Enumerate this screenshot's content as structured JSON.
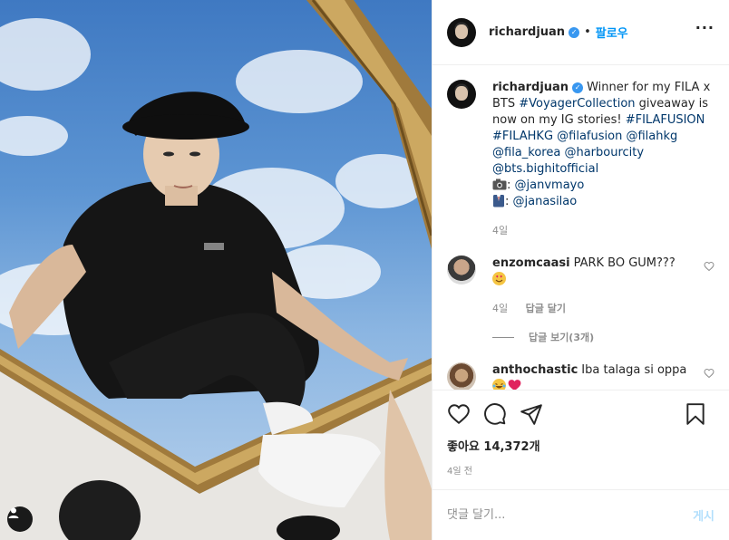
{
  "post": {
    "author": "richardjuan",
    "verified_icon": "verified-badge-icon",
    "separator": "•",
    "follow_label": "팔로우",
    "more_label": "···",
    "caption": {
      "text_intro": "Winner for my FILA x BTS ",
      "hashtag_voyager": "#VoyagerCollection",
      "text_mid": " giveaway is now on my IG stories! ",
      "hashtag_filafusion": "#FILAFUSION",
      "hashtag_filahkg": "#FILAHKG",
      "mention_filafusion": "@filafusion",
      "mention_filahkg": "@filahkg",
      "mention_fila_korea": "@fila_korea",
      "mention_harbourcity": "@harbourcity",
      "mention_bts": "@bts.bighitofficial",
      "camera_credit_label": ": ",
      "mention_janvmayo": "@janvmayo",
      "outfit_credit_label": ": ",
      "mention_janasilao": "@janasilao",
      "time": "4일"
    }
  },
  "comments": [
    {
      "user": "enzomcaasi",
      "text": "PARK BO GUM??? ",
      "emoji": "heart-eyes-emoji",
      "time": "4일",
      "reply_label": "답글 달기",
      "view_replies_label": "답글 보기(3개)"
    },
    {
      "user": "anthochastic",
      "text": "Iba talaga si oppa",
      "emoji": [
        "laughing-crying-emoji",
        "red-heart-emoji"
      ]
    }
  ],
  "actions": {
    "like_icon": "heart-outline-icon",
    "comment_icon": "comment-bubble-icon",
    "share_icon": "paper-plane-icon",
    "save_icon": "bookmark-icon"
  },
  "likes": {
    "label": "좋아요 14,372개"
  },
  "timestamp": "4일 전",
  "add_comment": {
    "placeholder": "댓글 달기...",
    "post_label": "게시"
  },
  "colors": {
    "link": "#00376b",
    "follow": "#0095f6",
    "muted": "#8e8e8e",
    "post_disabled": "#b2dffc",
    "verified": "#3897f0"
  }
}
